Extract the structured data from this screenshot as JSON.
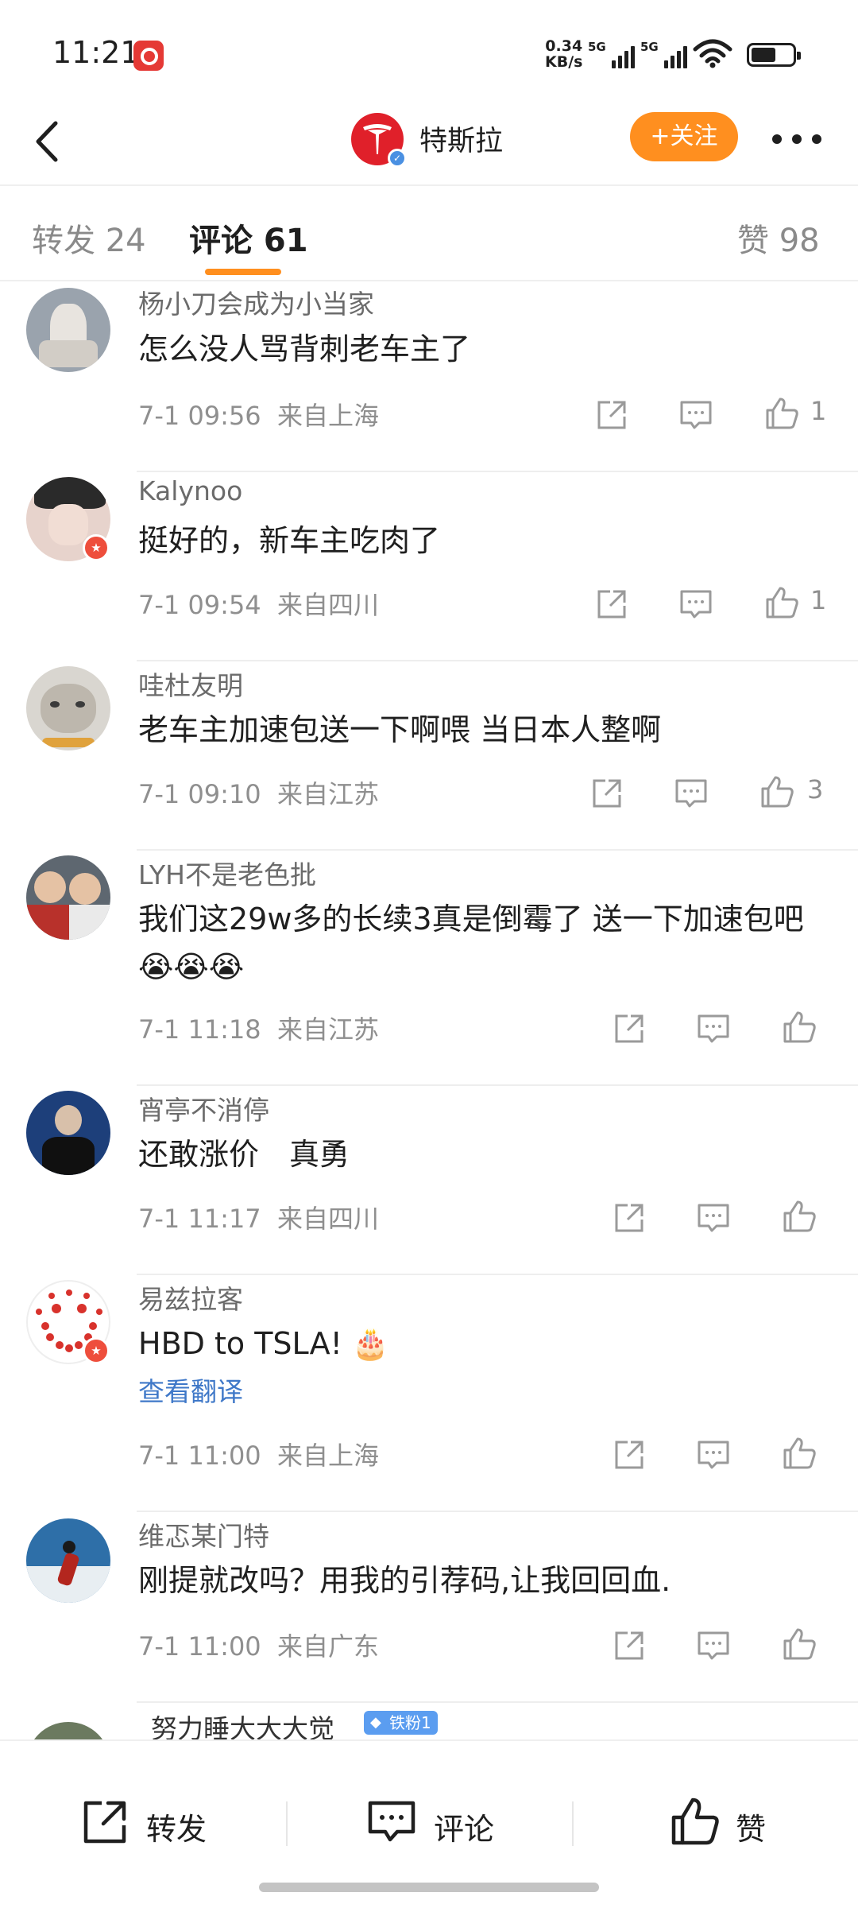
{
  "status_bar": {
    "time": "11:21",
    "net_speed_value": "0.34",
    "net_speed_unit": "KB/s",
    "signal1_label": "5G",
    "signal2_label": "5G",
    "battery_level": 0.6
  },
  "header": {
    "title": "特斯拉",
    "follow_label": "+关注"
  },
  "tabs": [
    {
      "label": "转发 24"
    },
    {
      "label": "评论 61"
    },
    {
      "label": "赞 98"
    }
  ],
  "comments": [
    {
      "name": "杨小刀会成为小当家",
      "text": "怎么没人骂背刺老车主了",
      "date": "7-1 09:56",
      "location": "来自上海",
      "likes": "1"
    },
    {
      "name": "Kalynoo",
      "text": "挺好的，新车主吃肉了",
      "date": "7-1 09:54",
      "location": "来自四川",
      "likes": "1"
    },
    {
      "name": "哇杜友明",
      "text": "老车主加速包送一下啊喂 当日本人整啊",
      "date": "7-1 09:10",
      "location": "来自江苏",
      "likes": "3"
    },
    {
      "name": "LYH不是老色批",
      "text": "我们这29w多的长续3真是倒霉了 送一下加速包吧😭😭😭",
      "date": "7-1 11:18",
      "location": "来自江苏",
      "likes": ""
    },
    {
      "name": "宵亭不消停",
      "text": "还敢涨价　真勇",
      "date": "7-1 11:17",
      "location": "来自四川",
      "likes": ""
    },
    {
      "name": "易兹拉客",
      "text": "HBD to TSLA! 🎂",
      "translate": "查看翻译",
      "date": "7-1 11:00",
      "location": "来自上海",
      "likes": ""
    },
    {
      "name": "维忑某门特",
      "text": "刚提就改吗？用我的引荐码,让我回回血.",
      "date": "7-1 11:00",
      "location": "来自广东",
      "likes": ""
    },
    {
      "name": "努力睡大大大觉",
      "badge": "铁粉1"
    }
  ],
  "bottom_bar": {
    "repost_label": "转发",
    "comment_label": "评论",
    "like_label": "赞"
  }
}
